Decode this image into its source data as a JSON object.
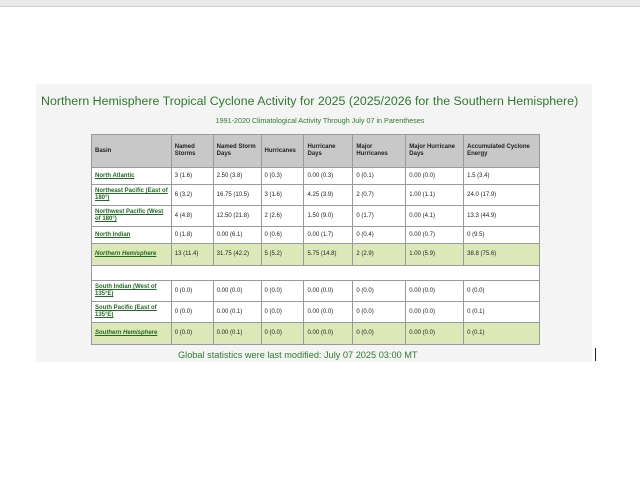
{
  "title": "Northern Hemisphere Tropical Cyclone Activity for 2025 (2025/2026 for the Southern Hemisphere)",
  "subtitle": "1991-2020 Climatological Activity Through July 07 in Parentheses",
  "headers": [
    "Basin",
    "Named Storms",
    "Named Storm Days",
    "Hurricanes",
    "Hurricane Days",
    "Major Hurricanes",
    "Major Hurricane Days",
    "Accumulated Cyclone Energy"
  ],
  "north_rows": [
    {
      "basin": "North Atlantic",
      "cells": [
        "3 (1.6)",
        "2.50 (3.8)",
        "0 (0.3)",
        "0.00 (0.3)",
        "0 (0.1)",
        "0.00 (0.0)",
        "1.5 (3.4)"
      ]
    },
    {
      "basin": "Northeast Pacific (East of 180°)",
      "cells": [
        "6 (3.2)",
        "16.75 (10.5)",
        "3 (1.6)",
        "4.25 (3.9)",
        "2 (0.7)",
        "1.00 (1.1)",
        "24.0 (17.9)"
      ]
    },
    {
      "basin": "Northwest Pacific (West of 180°)",
      "cells": [
        "4 (4.8)",
        "12.50 (21.8)",
        "2 (2.6)",
        "1.50 (9.0)",
        "0 (1.7)",
        "0.00 (4.1)",
        "13.3 (44.9)"
      ]
    },
    {
      "basin": "North Indian",
      "cells": [
        "0 (1.8)",
        "0.00 (6.1)",
        "0 (0.6)",
        "0.00 (1.7)",
        "0 (0.4)",
        "0.00 (0.7)",
        "0 (9.5)"
      ]
    }
  ],
  "north_total": {
    "basin": "Northern Hemisphere",
    "cells": [
      "13 (11.4)",
      "31.75 (42.2)",
      "5 (5.2)",
      "5.75 (14.8)",
      "2 (2.9)",
      "1.00 (5.9)",
      "38.8 (75.6)"
    ]
  },
  "south_rows": [
    {
      "basin": "South Indian (West of 135°E)",
      "cells": [
        "0 (0.0)",
        "0.00 (0.0)",
        "0 (0.0)",
        "0.00 (0.0)",
        "0 (0.0)",
        "0.00 (0.0)",
        "0 (0.0)"
      ]
    },
    {
      "basin": "South Pacific (East of 135°E)",
      "cells": [
        "0 (0.0)",
        "0.00 (0.1)",
        "0 (0.0)",
        "0.00 (0.0)",
        "0 (0.0)",
        "0.00 (0.0)",
        "0 (0.1)"
      ]
    }
  ],
  "south_total": {
    "basin": "Southern Hemisphere",
    "cells": [
      "0 (0.0)",
      "0.00 (0.1)",
      "0 (0.0)",
      "0.00 (0.0)",
      "0 (0.0)",
      "0.00 (0.0)",
      "0 (0.1)"
    ]
  },
  "footer": "Global statistics were last modified: July 07 2025 03:00 MT",
  "colors": {
    "title_green": "#2f7a2f",
    "link_green": "#1f6b1f",
    "total_row_bg": "#dde8b8",
    "header_bg": "#c8c8c8"
  }
}
